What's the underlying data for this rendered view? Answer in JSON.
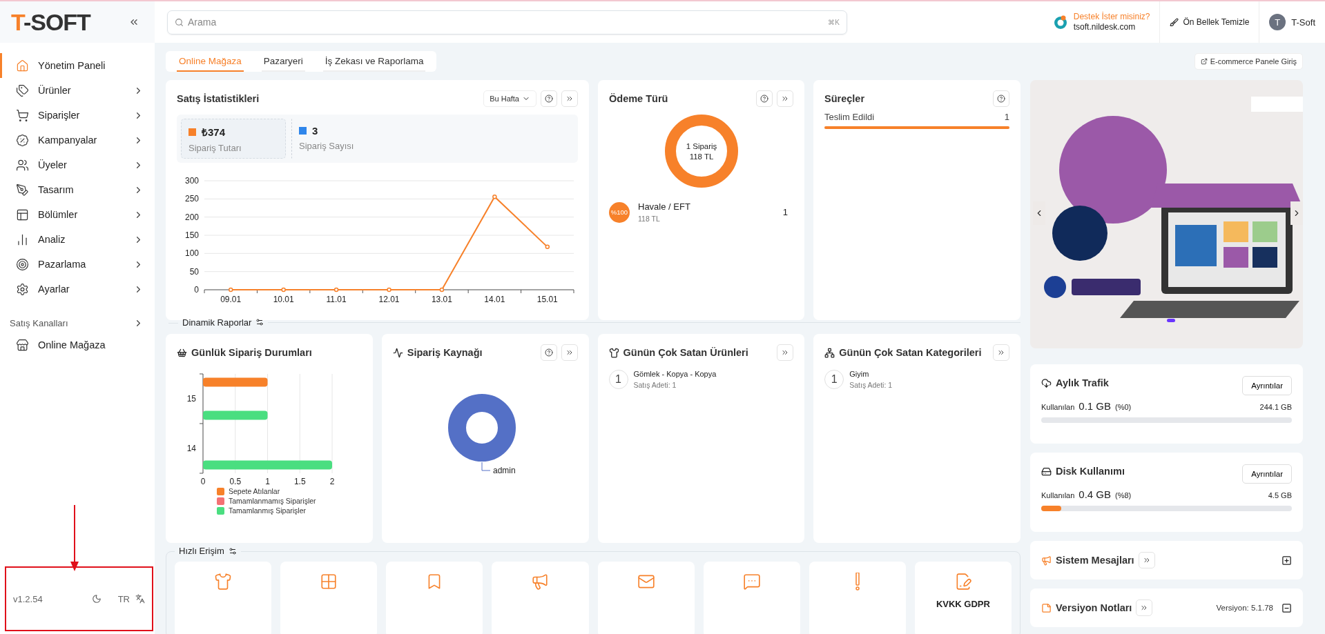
{
  "sidebar": {
    "logo": {
      "accent": "T",
      "rest": "-SOFT"
    },
    "items": [
      {
        "label": "Yönetim Paneli",
        "selected": true,
        "has_submenu": false
      },
      {
        "label": "Ürünler",
        "selected": false,
        "has_submenu": true
      },
      {
        "label": "Siparişler",
        "selected": false,
        "has_submenu": true
      },
      {
        "label": "Kampanyalar",
        "selected": false,
        "has_submenu": true
      },
      {
        "label": "Üyeler",
        "selected": false,
        "has_submenu": true
      },
      {
        "label": "Tasarım",
        "selected": false,
        "has_submenu": true
      },
      {
        "label": "Bölümler",
        "selected": false,
        "has_submenu": true
      },
      {
        "label": "Analiz",
        "selected": false,
        "has_submenu": true
      },
      {
        "label": "Pazarlama",
        "selected": false,
        "has_submenu": true
      },
      {
        "label": "Ayarlar",
        "selected": false,
        "has_submenu": true
      }
    ],
    "channels": {
      "label": "Satış Kanalları",
      "items": [
        {
          "label": "Online Mağaza",
          "selected": false
        }
      ]
    },
    "footer": {
      "version": "v1.2.54",
      "language": "TR"
    }
  },
  "header": {
    "search": {
      "placeholder": "Arama",
      "shortcut": "⌘K"
    },
    "support": {
      "title": "Destek İster misiniz?",
      "link": "tsoft.nildesk.com"
    },
    "cache_button": "Ön Bellek Temizle",
    "user": {
      "initial": "T",
      "name": "T-Soft"
    }
  },
  "tabs": [
    {
      "label": "Online Mağaza",
      "selected": true
    },
    {
      "label": "Pazaryeri",
      "selected": false
    },
    {
      "label": "İş Zekası ve Raporlama",
      "selected": false
    }
  ],
  "ecommerce_button": "E-commerce Panele Giriş",
  "sales_stats": {
    "title": "Satış İstatistikleri",
    "period": "Bu Hafta",
    "metrics": [
      {
        "value": "₺374",
        "label": "Sipariş Tutarı",
        "color": "#f7812a",
        "selected": true
      },
      {
        "value": "3",
        "label": "Sipariş Sayısı",
        "color": "#2f86eb",
        "selected": false
      }
    ],
    "chart_data": {
      "type": "line",
      "categories": [
        "09.01",
        "10.01",
        "11.01",
        "12.01",
        "13.01",
        "14.01",
        "15.01"
      ],
      "series": [
        {
          "color": "#f7812a",
          "marker": true,
          "values": [
            0,
            0,
            0,
            0,
            0,
            256,
            118
          ]
        }
      ],
      "ylim": [
        0,
        300
      ],
      "yticks": [
        0,
        50,
        100,
        150,
        200,
        250,
        300
      ],
      "grid": true
    }
  },
  "payment_types": {
    "title": "Ödeme Türü",
    "center_lines": [
      "1 Sipariş",
      "118 TL"
    ],
    "items": [
      {
        "badge": "%100",
        "name": "Havale / EFT",
        "amount": "118 TL",
        "count": "1"
      }
    ]
  },
  "processes": {
    "title": "Süreçler",
    "items": [
      {
        "label": "Teslim Edildi",
        "count": "1",
        "level": 1
      }
    ]
  },
  "dynamic_reports": {
    "title": "Dinamik Raporlar"
  },
  "daily_orders": {
    "title": "Günlük Sipariş Durumları",
    "chart_data": {
      "type": "bar",
      "orientation": "horizontal",
      "categories": [
        "15",
        "14"
      ],
      "series": [
        {
          "name": "Sepete Atılanlar",
          "color": "#f7812a",
          "values": [
            1,
            0
          ]
        },
        {
          "name": "Tamamlanmamış Siparişler",
          "color": "#f47174",
          "values": [
            0,
            0
          ]
        },
        {
          "name": "Tamamlanmış Siparişler",
          "color": "#4ade80",
          "values": [
            1,
            2
          ]
        }
      ],
      "xlim": [
        0,
        2
      ],
      "xticks": [
        0,
        0.5,
        1,
        1.5,
        2
      ],
      "grid": true
    }
  },
  "order_source": {
    "title": "Sipariş Kaynağı",
    "label": "admin"
  },
  "top_products": {
    "title": "Günün Çok Satan Ürünleri",
    "items": [
      {
        "rank": "1",
        "name": "Gömlek - Kopya - Kopya",
        "detail": "Satış Adeti: 1"
      }
    ]
  },
  "top_categories": {
    "title": "Günün Çok Satan Kategorileri",
    "items": [
      {
        "rank": "1",
        "name": "Giyim",
        "detail": "Satış Adeti: 1"
      }
    ]
  },
  "usage": [
    {
      "title": "Aylık Trafik",
      "button": "Ayrıntılar",
      "used_label": "Kullanılan",
      "used": "0.1 GB",
      "percent": "(%0)",
      "total": "244.1 GB",
      "level": 0
    },
    {
      "title": "Disk Kullanımı",
      "button": "Ayrıntılar",
      "used_label": "Kullanılan",
      "used": "0.4 GB",
      "percent": "(%8)",
      "total": "4.5 GB",
      "level": 0.08
    }
  ],
  "system_messages": {
    "title": "Sistem Mesajları",
    "expanded": false
  },
  "version_notes": {
    "title": "Versiyon Notları",
    "version": "Versiyon: 5.1.78",
    "expanded": true
  },
  "quick_access": {
    "title": "Hızlı Erişim",
    "tiles": [
      {
        "kind": "shirt"
      },
      {
        "kind": "grid"
      },
      {
        "kind": "bookmark"
      },
      {
        "kind": "megaphone"
      },
      {
        "kind": "mail"
      },
      {
        "kind": "chat"
      },
      {
        "kind": "exclamation"
      },
      {
        "kind": "document",
        "label": "KVKK GDPR"
      }
    ]
  }
}
